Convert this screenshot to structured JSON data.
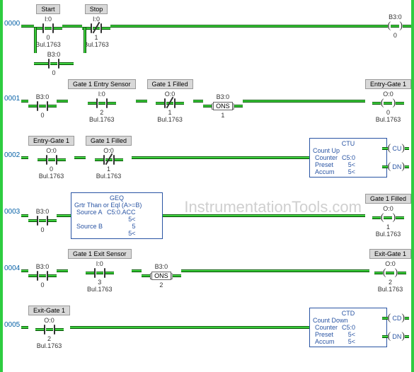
{
  "watermark": "InstrumentationTools.com",
  "rungs": [
    {
      "num": "0000",
      "contacts": [
        {
          "label": "Start",
          "addr": "I:0",
          "bit": "0",
          "bul": "Bul.1763",
          "type": "NO"
        },
        {
          "label": "Stop",
          "addr": "I:0",
          "bit": "1",
          "bul": "Bul.1763",
          "type": "NC"
        }
      ],
      "parallel": {
        "addr": "B3:0",
        "bit": "0",
        "type": "NO"
      },
      "output": {
        "addr": "B3:0",
        "bit": "0",
        "type": "COIL"
      }
    },
    {
      "num": "0001",
      "contacts": [
        {
          "addr": "B3:0",
          "bit": "0",
          "type": "NO"
        },
        {
          "label": "Gate 1 Entry Sensor",
          "addr": "I:0",
          "bit": "2",
          "bul": "Bul.1763",
          "type": "NO"
        },
        {
          "label": "Gate 1 Filled",
          "addr": "O:0",
          "bit": "1",
          "bul": "Bul.1763",
          "type": "NC"
        },
        {
          "addr": "B3:0",
          "bit": "1",
          "type": "ONS"
        }
      ],
      "output": {
        "label": "Entry-Gate 1",
        "addr": "O:0",
        "bit": "0",
        "bul": "Bul.1763",
        "type": "COIL"
      }
    },
    {
      "num": "0002",
      "contacts": [
        {
          "label": "Entry-Gate 1",
          "addr": "O:0",
          "bit": "0",
          "bul": "Bul.1763",
          "type": "NO"
        },
        {
          "label": "Gate 1 Filled",
          "addr": "O:0",
          "bit": "1",
          "bul": "Bul.1763",
          "type": "NC"
        }
      ],
      "block": {
        "type": "CTU",
        "title": "Count Up",
        "rows": [
          [
            "Counter",
            "C5:0"
          ],
          [
            "Preset",
            "5<"
          ],
          [
            "Accum",
            "5<"
          ]
        ],
        "outs": [
          "CU",
          "DN"
        ]
      }
    },
    {
      "num": "0003",
      "contacts": [
        {
          "addr": "B3:0",
          "bit": "0",
          "type": "NO"
        }
      ],
      "block": {
        "type": "GEQ",
        "title": "Grtr Than or Eql (A>=B)",
        "rows": [
          [
            "Source A",
            "C5:0.ACC"
          ],
          [
            "",
            "5<"
          ],
          [
            "Source B",
            "5"
          ],
          [
            "",
            "5<"
          ]
        ]
      },
      "output": {
        "label": "Gate 1 Filled",
        "addr": "O:0",
        "bit": "1",
        "bul": "Bul.1763",
        "type": "COIL"
      }
    },
    {
      "num": "0004",
      "contacts": [
        {
          "addr": "B3:0",
          "bit": "0",
          "type": "NO"
        },
        {
          "label": "Gate 1 Exit Sensor",
          "addr": "I:0",
          "bit": "3",
          "bul": "Bul.1763",
          "type": "NO"
        },
        {
          "addr": "B3:0",
          "bit": "2",
          "type": "ONS"
        }
      ],
      "output": {
        "label": "Exit-Gate 1",
        "addr": "O:0",
        "bit": "2",
        "bul": "Bul.1763",
        "type": "COIL"
      }
    },
    {
      "num": "0005",
      "contacts": [
        {
          "label": "Exit-Gate 1",
          "addr": "O:0",
          "bit": "2",
          "bul": "Bul.1763",
          "type": "NO"
        }
      ],
      "block": {
        "type": "CTD",
        "title": "Count Down",
        "rows": [
          [
            "Counter",
            "C5:0"
          ],
          [
            "Preset",
            "5<"
          ],
          [
            "Accum",
            "5<"
          ]
        ],
        "outs": [
          "CD",
          "DN"
        ]
      }
    }
  ]
}
